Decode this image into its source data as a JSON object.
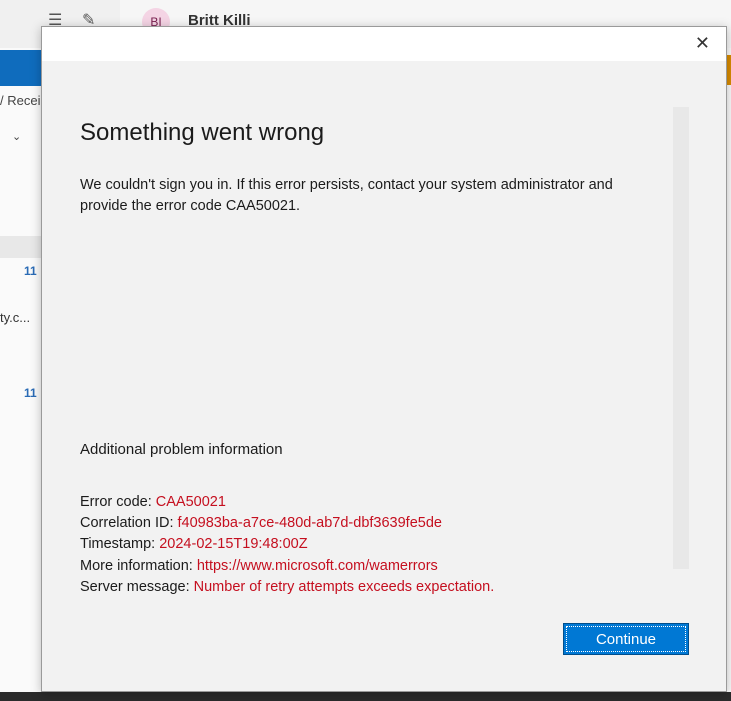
{
  "background": {
    "avatar_initials": "BI",
    "sender": "Britt Killi",
    "folder_partial": "/ Recei",
    "row_numbers": [
      "11",
      "11"
    ],
    "truncated_text": "ty.c..."
  },
  "dialog": {
    "close_label": "✕",
    "title": "Something went wrong",
    "message": "We couldn't sign you in. If this error persists, contact your system administrator and provide the error code CAA50021.",
    "additional_heading": "Additional problem information",
    "details": [
      {
        "label": "Error code: ",
        "value": "CAA50021"
      },
      {
        "label": "Correlation ID: ",
        "value": "f40983ba-a7ce-480d-ab7d-dbf3639fe5de"
      },
      {
        "label": "Timestamp: ",
        "value": "2024-02-15T19:48:00Z"
      },
      {
        "label": "More information: ",
        "value": "https://www.microsoft.com/wamerrors"
      },
      {
        "label": "Server message: ",
        "value": "Number of retry attempts exceeds expectation."
      }
    ],
    "continue_label": "Continue"
  }
}
